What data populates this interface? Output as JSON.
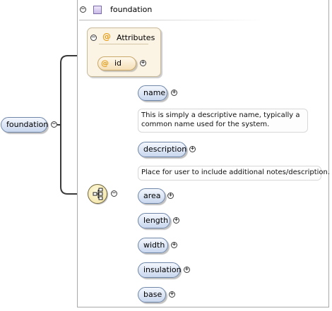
{
  "root": {
    "label": "foundation",
    "toggle": "−"
  },
  "frame": {
    "title": "foundation",
    "toggle": "−"
  },
  "attributes": {
    "header": "Attributes",
    "toggle": "−",
    "at_symbol": "@",
    "items": [
      {
        "label": "id",
        "expand": "+"
      }
    ]
  },
  "sequence": {
    "toggle": "−"
  },
  "elements": [
    {
      "label": "name",
      "expand": "+",
      "doc": "This is simply a descriptive name, typically a common name used for the system."
    },
    {
      "label": "description",
      "expand": "+",
      "doc": "Place for user to include additional notes/description."
    },
    {
      "label": "area",
      "expand": "+"
    },
    {
      "label": "length",
      "expand": "+"
    },
    {
      "label": "width",
      "expand": "+"
    },
    {
      "label": "insulation",
      "expand": "+"
    },
    {
      "label": "base",
      "expand": "+"
    }
  ],
  "colors": {
    "element_pill": "#c9d7ee",
    "attribute_pill": "#f5dfb6",
    "attribute_box": "#fbf3e4",
    "sequence_icon": "#f1e09c",
    "connector": "#3a3a3a"
  }
}
